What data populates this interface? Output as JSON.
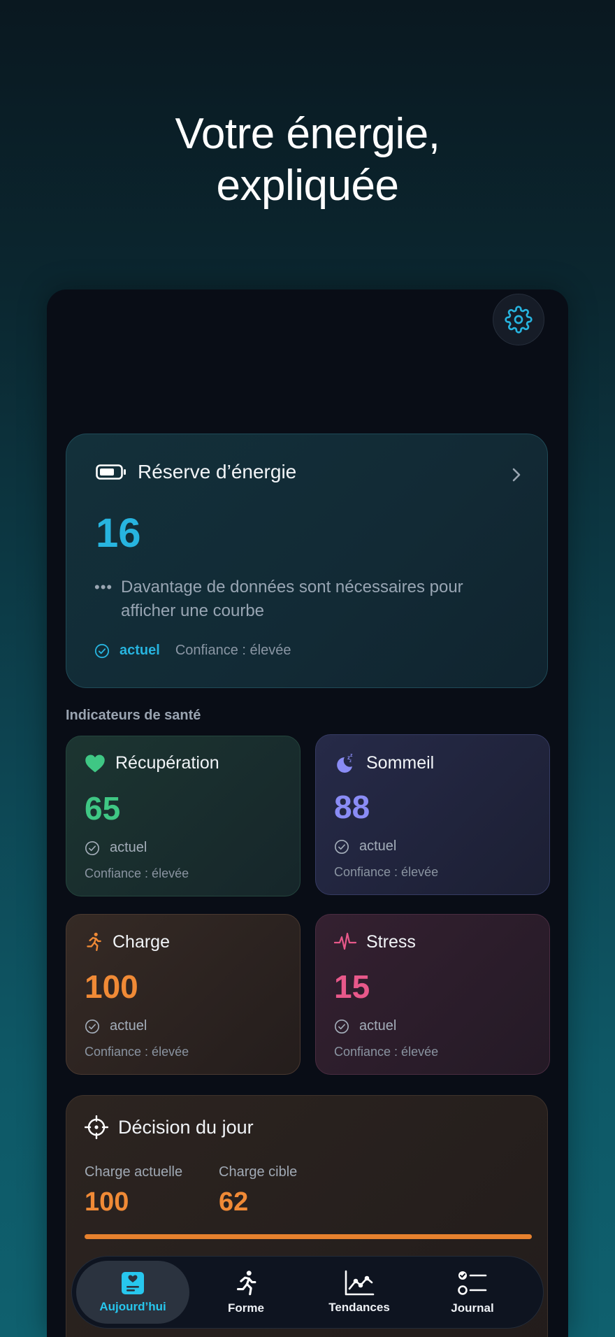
{
  "hero": {
    "line1": "Votre énergie,",
    "line2": "expliquée"
  },
  "header": {
    "settings_icon": "gear-icon"
  },
  "energy_card": {
    "icon": "battery-icon",
    "title": "Réserve d’énergie",
    "value": "16",
    "note": "Davantage de données sont nécessaires pour afficher une courbe",
    "status": "actuel",
    "confidence": "Confiance : élevée",
    "accent": "#27b4df"
  },
  "section_label": "Indicateurs de santé",
  "metrics": {
    "recovery": {
      "icon": "heart-icon",
      "title": "Récupération",
      "value": "65",
      "status": "actuel",
      "confidence": "Confiance : élevée",
      "color": "#3fc784"
    },
    "sleep": {
      "icon": "moon-icon",
      "title": "Sommeil",
      "value": "88",
      "status": "actuel",
      "confidence": "Confiance : élevée",
      "color": "#8a8cf5"
    },
    "load": {
      "icon": "running-icon",
      "title": "Charge",
      "value": "100",
      "status": "actuel",
      "confidence": "Confiance : élevée",
      "color": "#f08a36"
    },
    "stress": {
      "icon": "heartbeat-icon",
      "title": "Stress",
      "value": "15",
      "status": "actuel",
      "confidence": "Confiance : élevée",
      "color": "#e8588a"
    }
  },
  "decision": {
    "icon": "target-icon",
    "title": "Décision du jour",
    "current_label": "Charge actuelle",
    "current_value": "100",
    "target_label": "Charge cible",
    "target_value": "62",
    "progress": 1.0
  },
  "tabbar": {
    "tabs": [
      {
        "label": "Aujourd’hui",
        "icon": "today-card-icon",
        "active": true
      },
      {
        "label": "Forme",
        "icon": "running-icon",
        "active": false
      },
      {
        "label": "Tendances",
        "icon": "chart-icon",
        "active": false
      },
      {
        "label": "Journal",
        "icon": "checklist-icon",
        "active": false
      }
    ]
  }
}
